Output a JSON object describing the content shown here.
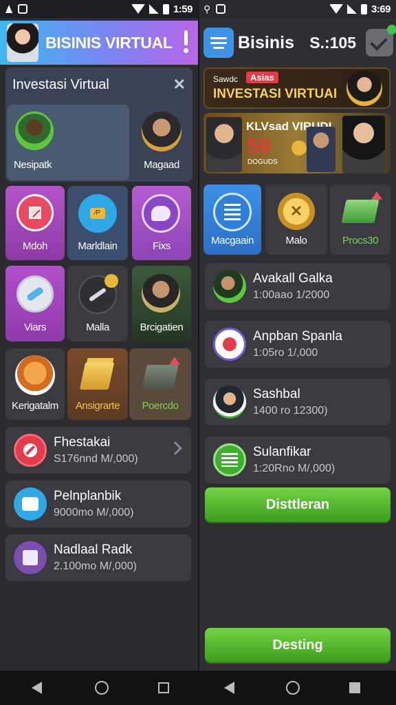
{
  "left_status": {
    "time": "1:59"
  },
  "right_status": {
    "time": "3:69"
  },
  "left": {
    "header_title": "BISINIS VIRTUAL",
    "panel_title": "Investasi Virtual",
    "grid": [
      {
        "label": "Nesipatk"
      },
      {
        "label": "Magaad"
      },
      {
        "label": "Mdoh"
      },
      {
        "label": "Marldlain"
      },
      {
        "label": "Fixs"
      },
      {
        "label": "Viars"
      },
      {
        "label": "Malla"
      },
      {
        "label": "Brcigatien"
      },
      {
        "label": "Kerigatalm"
      },
      {
        "label": "Ansigrarte"
      },
      {
        "label": "Poercdo"
      }
    ],
    "list": [
      {
        "title": "Fhestakai",
        "sub": "S176nnd M/,000)"
      },
      {
        "title": "Pelnplanbik",
        "sub": "9000mo M/,000)"
      },
      {
        "title": "Nadlaal Radk",
        "sub": "2.100mo M/,000)"
      }
    ]
  },
  "right": {
    "header_title": "Bisinis",
    "score": "S.:105",
    "banner1": {
      "small": "Sawdc",
      "tag": "Asias",
      "headline": "INVESTASI VIRTUAI"
    },
    "banner2": {
      "headline": "KLVsad VIRUDI",
      "number": "59",
      "sub": "DOGUDS"
    },
    "tiles": [
      {
        "label": "Macgaain"
      },
      {
        "label": "Malo"
      },
      {
        "label": "Procs30"
      }
    ],
    "list": [
      {
        "title": "Avakall Galka",
        "sub": "1:00aao 1/2000"
      },
      {
        "title": "Anpban Spanla",
        "sub": "1:05ro 1/,000"
      },
      {
        "title": "Sashbal",
        "sub": "1400 ro 12300)"
      },
      {
        "title": "Sulanfikar",
        "sub": "1:20Rno M/,000)"
      }
    ],
    "button1": "Disttleran",
    "button2": "Desting"
  },
  "colors": {
    "green": "#4caf2a",
    "header_gradient": [
      "#3fb7ee",
      "#b865e6"
    ],
    "accent_blue": "#3f93e6"
  }
}
